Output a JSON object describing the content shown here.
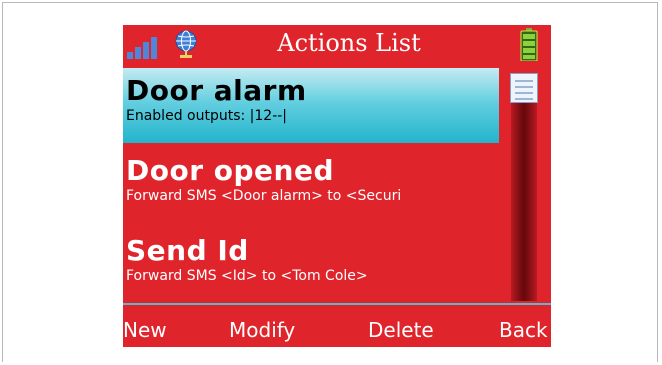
{
  "title_bar": {
    "title": "Actions List",
    "icons": [
      "signal-strength-icon",
      "globe-network-icon",
      "battery-icon"
    ]
  },
  "actions": [
    {
      "name": "Door alarm",
      "detail": "Enabled outputs: |12--|",
      "selected": true
    },
    {
      "name": "Door opened",
      "detail": "Forward SMS <Door alarm> to <Securi",
      "selected": false
    },
    {
      "name": "Send Id",
      "detail": "Forward SMS <Id> to <Tom Cole>",
      "selected": false
    }
  ],
  "softkeys": {
    "new": "New",
    "modify": "Modify",
    "delete": "Delete",
    "back": "Back"
  },
  "colors": {
    "screen_background": "#e0242b",
    "selection_highlight": "#23b4cc",
    "divider": "#5fb7cf",
    "text": "#ffffff"
  }
}
